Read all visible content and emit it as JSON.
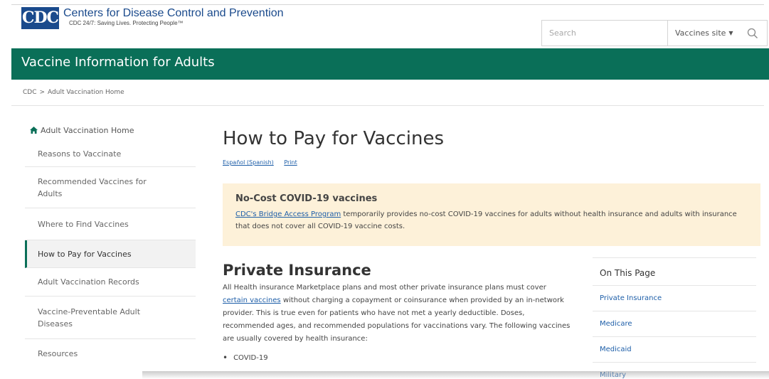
{
  "header": {
    "logo_mark": "CDC",
    "logo_title": "Centers for Disease Control and Prevention",
    "logo_tagline": "CDC 24/7: Saving Lives. Protecting People™",
    "search_placeholder": "Search",
    "site_select": "Vaccines site"
  },
  "banner": {
    "title": "Vaccine Information for Adults"
  },
  "breadcrumb": {
    "items": [
      "CDC",
      "Adult Vaccination Home"
    ],
    "separator": ">"
  },
  "sidebar": {
    "home": "Adult Vaccination Home",
    "items": [
      {
        "label": "Reasons to Vaccinate"
      },
      {
        "label": "Recommended Vaccines for Adults"
      },
      {
        "label": "Where to Find Vaccines"
      },
      {
        "label": "How to Pay for Vaccines"
      },
      {
        "label": "Adult Vaccination Records"
      },
      {
        "label": "Vaccine-Preventable Adult Diseases"
      },
      {
        "label": "Resources"
      }
    ],
    "active_index": 3
  },
  "main": {
    "title": "How to Pay for Vaccines",
    "lang_link": "Español (Spanish)",
    "print_link": "Print",
    "callout": {
      "title": "No-Cost COVID-19 vaccines",
      "link": "CDC's Bridge Access Program",
      "body": " temporarily provides no-cost COVID-19 vaccines for adults without health insurance and adults with insurance that does not cover all COVID-19 vaccine costs."
    },
    "private_insurance": {
      "title": "Private Insurance",
      "body_1": "All Health insurance Marketplace plans and most other private insurance plans must cover ",
      "link": "certain vaccines",
      "body_2": " without charging a copayment or coinsurance when provided by an in-network provider. This is true even for patients who have not met a yearly deductible. Doses, recommended ages, and recommended populations for vaccinations vary. The following vaccines are usually covered by health insurance:",
      "bullet_1": "COVID-19"
    },
    "on_this_page": {
      "title": "On This Page",
      "items": [
        "Private Insurance",
        "Medicare",
        "Medicaid",
        "Military"
      ]
    }
  },
  "colors": {
    "brand_blue": "#1a4a8c",
    "banner_green": "#0a6f58",
    "callout_bg": "#fdf1d9",
    "link_blue": "#1d5ea8"
  }
}
